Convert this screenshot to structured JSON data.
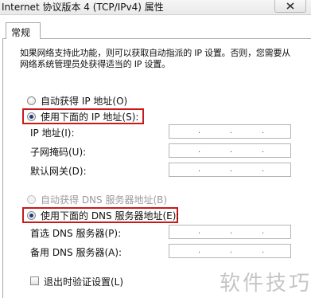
{
  "window": {
    "title": "Internet 协议版本 4 (TCP/IPv4) 属性"
  },
  "tabs": [
    {
      "label": "常规"
    }
  ],
  "description": "如果网络支持此功能，则可以获取自动指派的 IP 设置。否则，您需要从网络系统管理员处获得适当的 IP 设置。",
  "ip_section": {
    "auto_option": "自动获得 IP 地址(O)",
    "manual_option": "使用下面的 IP 地址(S):",
    "selected": "manual",
    "fields": [
      {
        "label": "IP 地址(I):",
        "value": ""
      },
      {
        "label": "子网掩码(U):",
        "value": ""
      },
      {
        "label": "默认网关(D):",
        "value": ""
      }
    ]
  },
  "dns_section": {
    "auto_option": "自动获得 DNS 服务器地址(B)",
    "manual_option": "使用下面的 DNS 服务器地址(E):",
    "selected": "manual",
    "fields": [
      {
        "label": "首选 DNS 服务器(P):",
        "value": ""
      },
      {
        "label": "备用 DNS 服务器(A):",
        "value": ""
      }
    ]
  },
  "validate_checkbox": {
    "label": "退出时验证设置(L)",
    "checked": false
  },
  "watermark": "软件技巧",
  "colors": {
    "highlight": "#c81a1a",
    "radio_dot": "#1c3d7a",
    "border": "#a8a8a8"
  }
}
